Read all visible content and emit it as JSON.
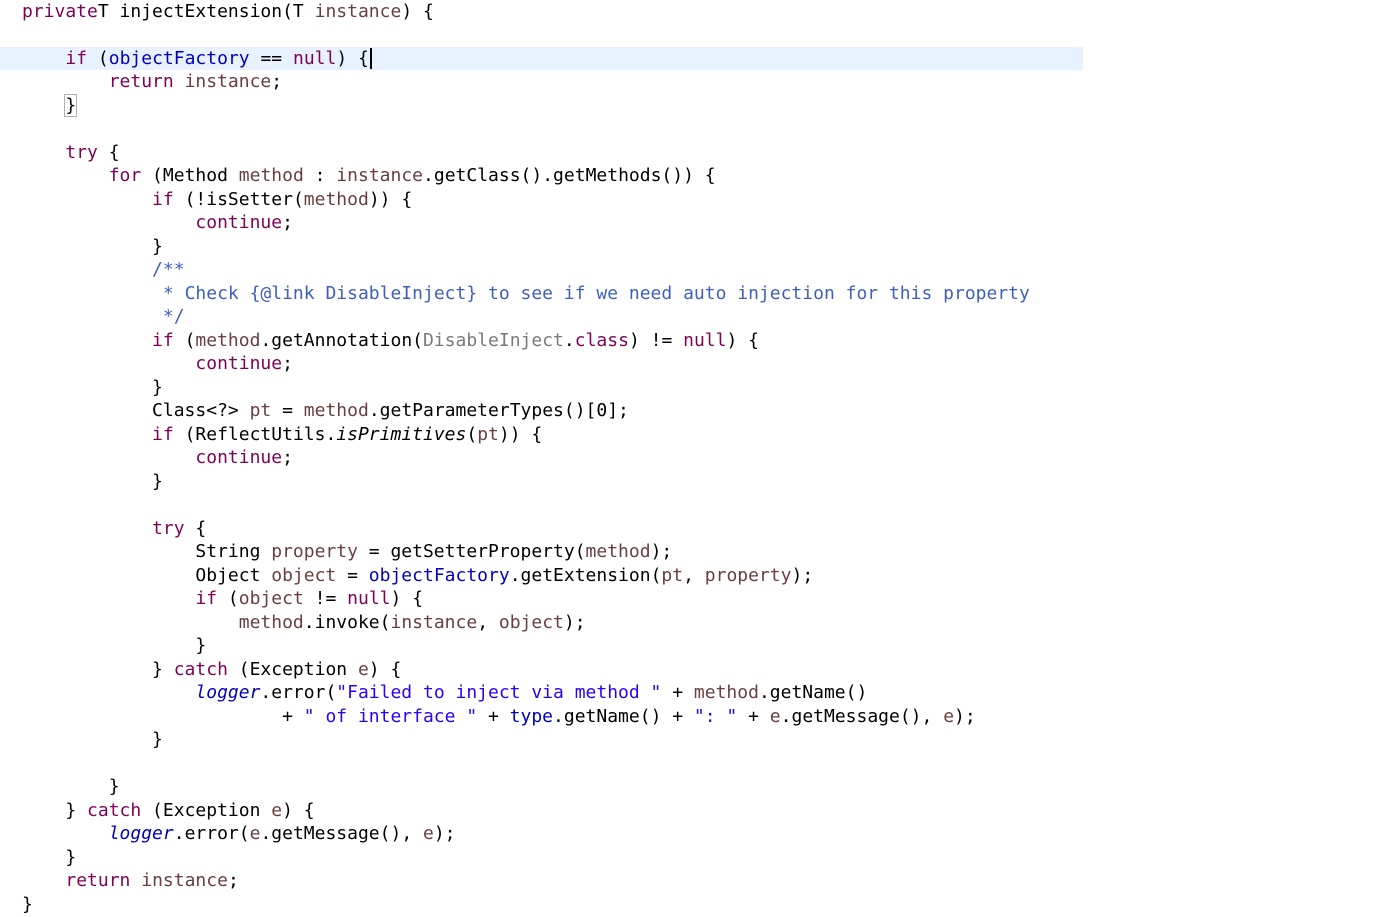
{
  "editor": {
    "language": "java",
    "current_line_index": 2,
    "cursor_after_text": "if (objectFactory == null) {",
    "matched_bracket_line_index": 4,
    "colors": {
      "keyword": "#7f0055",
      "local_variable": "#6a3e3e",
      "field": "#0000c0",
      "string": "#2a00ff",
      "javadoc": "#3f5fbf",
      "current_line_highlight": "#e8f2fe"
    },
    "lines": [
      [
        [
          "kw",
          "private"
        ],
        [
          "",
          "T injectExtension(T "
        ],
        [
          "var",
          "instance"
        ],
        [
          "",
          ") {"
        ]
      ],
      [],
      [
        [
          "",
          "    "
        ],
        [
          "kw",
          "if"
        ],
        [
          "",
          " ("
        ],
        [
          "field",
          "objectFactory"
        ],
        [
          "",
          " == "
        ],
        [
          "kw",
          "null"
        ],
        [
          "",
          ") {"
        ]
      ],
      [
        [
          "",
          "        "
        ],
        [
          "kw",
          "return"
        ],
        [
          "",
          " "
        ],
        [
          "var",
          "instance"
        ],
        [
          "",
          ";"
        ]
      ],
      [
        [
          "",
          "    "
        ],
        [
          "bm",
          "}"
        ]
      ],
      [],
      [
        [
          "",
          "    "
        ],
        [
          "kw",
          "try"
        ],
        [
          "",
          " {"
        ]
      ],
      [
        [
          "",
          "        "
        ],
        [
          "kw",
          "for"
        ],
        [
          "",
          " (Method "
        ],
        [
          "var",
          "method"
        ],
        [
          "",
          " : "
        ],
        [
          "var",
          "instance"
        ],
        [
          "",
          ".getClass().getMethods()) {"
        ]
      ],
      [
        [
          "",
          "            "
        ],
        [
          "kw",
          "if"
        ],
        [
          "",
          " (!isSetter("
        ],
        [
          "var",
          "method"
        ],
        [
          "",
          ")) {"
        ]
      ],
      [
        [
          "",
          "                "
        ],
        [
          "kw",
          "continue"
        ],
        [
          "",
          ";"
        ]
      ],
      [
        [
          "",
          "            }"
        ]
      ],
      [
        [
          "",
          "            "
        ],
        [
          "doc",
          "/**"
        ]
      ],
      [
        [
          "",
          "             "
        ],
        [
          "doc",
          "* Check {@link DisableInject} to see if we need auto injection for this property"
        ]
      ],
      [
        [
          "",
          "             "
        ],
        [
          "doc",
          "*/"
        ]
      ],
      [
        [
          "",
          "            "
        ],
        [
          "kw",
          "if"
        ],
        [
          "",
          " ("
        ],
        [
          "var",
          "method"
        ],
        [
          "",
          ".getAnnotation("
        ],
        [
          "unused",
          "DisableInject"
        ],
        [
          "",
          "."
        ],
        [
          "kw",
          "class"
        ],
        [
          "",
          ") != "
        ],
        [
          "kw",
          "null"
        ],
        [
          "",
          ") {"
        ]
      ],
      [
        [
          "",
          "                "
        ],
        [
          "kw",
          "continue"
        ],
        [
          "",
          ";"
        ]
      ],
      [
        [
          "",
          "            }"
        ]
      ],
      [
        [
          "",
          "            Class<?> "
        ],
        [
          "var",
          "pt"
        ],
        [
          "",
          " = "
        ],
        [
          "var",
          "method"
        ],
        [
          "",
          ".getParameterTypes()[0];"
        ]
      ],
      [
        [
          "",
          "            "
        ],
        [
          "kw",
          "if"
        ],
        [
          "",
          " (ReflectUtils."
        ],
        [
          "smeth",
          "isPrimitives"
        ],
        [
          "",
          "("
        ],
        [
          "var",
          "pt"
        ],
        [
          "",
          ")) {"
        ]
      ],
      [
        [
          "",
          "                "
        ],
        [
          "kw",
          "continue"
        ],
        [
          "",
          ";"
        ]
      ],
      [
        [
          "",
          "            }"
        ]
      ],
      [],
      [
        [
          "",
          "            "
        ],
        [
          "kw",
          "try"
        ],
        [
          "",
          " {"
        ]
      ],
      [
        [
          "",
          "                String "
        ],
        [
          "var",
          "property"
        ],
        [
          "",
          " = getSetterProperty("
        ],
        [
          "var",
          "method"
        ],
        [
          "",
          ");"
        ]
      ],
      [
        [
          "",
          "                Object "
        ],
        [
          "var",
          "object"
        ],
        [
          "",
          " = "
        ],
        [
          "field",
          "objectFactory"
        ],
        [
          "",
          ".getExtension("
        ],
        [
          "var",
          "pt"
        ],
        [
          "",
          ", "
        ],
        [
          "var",
          "property"
        ],
        [
          "",
          ");"
        ]
      ],
      [
        [
          "",
          "                "
        ],
        [
          "kw",
          "if"
        ],
        [
          "",
          " ("
        ],
        [
          "var",
          "object"
        ],
        [
          "",
          " != "
        ],
        [
          "kw",
          "null"
        ],
        [
          "",
          ") {"
        ]
      ],
      [
        [
          "",
          "                    "
        ],
        [
          "var",
          "method"
        ],
        [
          "",
          ".invoke("
        ],
        [
          "var",
          "instance"
        ],
        [
          "",
          ", "
        ],
        [
          "var",
          "object"
        ],
        [
          "",
          ");"
        ]
      ],
      [
        [
          "",
          "                }"
        ]
      ],
      [
        [
          "",
          "            } "
        ],
        [
          "kw",
          "catch"
        ],
        [
          "",
          " (Exception "
        ],
        [
          "var",
          "e"
        ],
        [
          "",
          ") {"
        ]
      ],
      [
        [
          "",
          "                "
        ],
        [
          "sfield",
          "logger"
        ],
        [
          "",
          ".error("
        ],
        [
          "str",
          "\"Failed to inject via method \""
        ],
        [
          "",
          " + "
        ],
        [
          "var",
          "method"
        ],
        [
          "",
          ".getName()"
        ]
      ],
      [
        [
          "",
          "                        + "
        ],
        [
          "str",
          "\" of interface \""
        ],
        [
          "",
          " + "
        ],
        [
          "field",
          "type"
        ],
        [
          "",
          ".getName() + "
        ],
        [
          "str",
          "\": \""
        ],
        [
          "",
          " + "
        ],
        [
          "var",
          "e"
        ],
        [
          "",
          ".getMessage(), "
        ],
        [
          "var",
          "e"
        ],
        [
          "",
          ");"
        ]
      ],
      [
        [
          "",
          "            }"
        ]
      ],
      [],
      [
        [
          "",
          "        }"
        ]
      ],
      [
        [
          "",
          "    } "
        ],
        [
          "kw",
          "catch"
        ],
        [
          "",
          " (Exception "
        ],
        [
          "var",
          "e"
        ],
        [
          "",
          ") {"
        ]
      ],
      [
        [
          "",
          "        "
        ],
        [
          "sfield",
          "logger"
        ],
        [
          "",
          ".error("
        ],
        [
          "var",
          "e"
        ],
        [
          "",
          ".getMessage(), "
        ],
        [
          "var",
          "e"
        ],
        [
          "",
          ");"
        ]
      ],
      [
        [
          "",
          "    }"
        ]
      ],
      [
        [
          "",
          "    "
        ],
        [
          "kw",
          "return"
        ],
        [
          "",
          " "
        ],
        [
          "var",
          "instance"
        ],
        [
          "",
          ";"
        ]
      ],
      [
        [
          "",
          "}"
        ]
      ]
    ]
  }
}
